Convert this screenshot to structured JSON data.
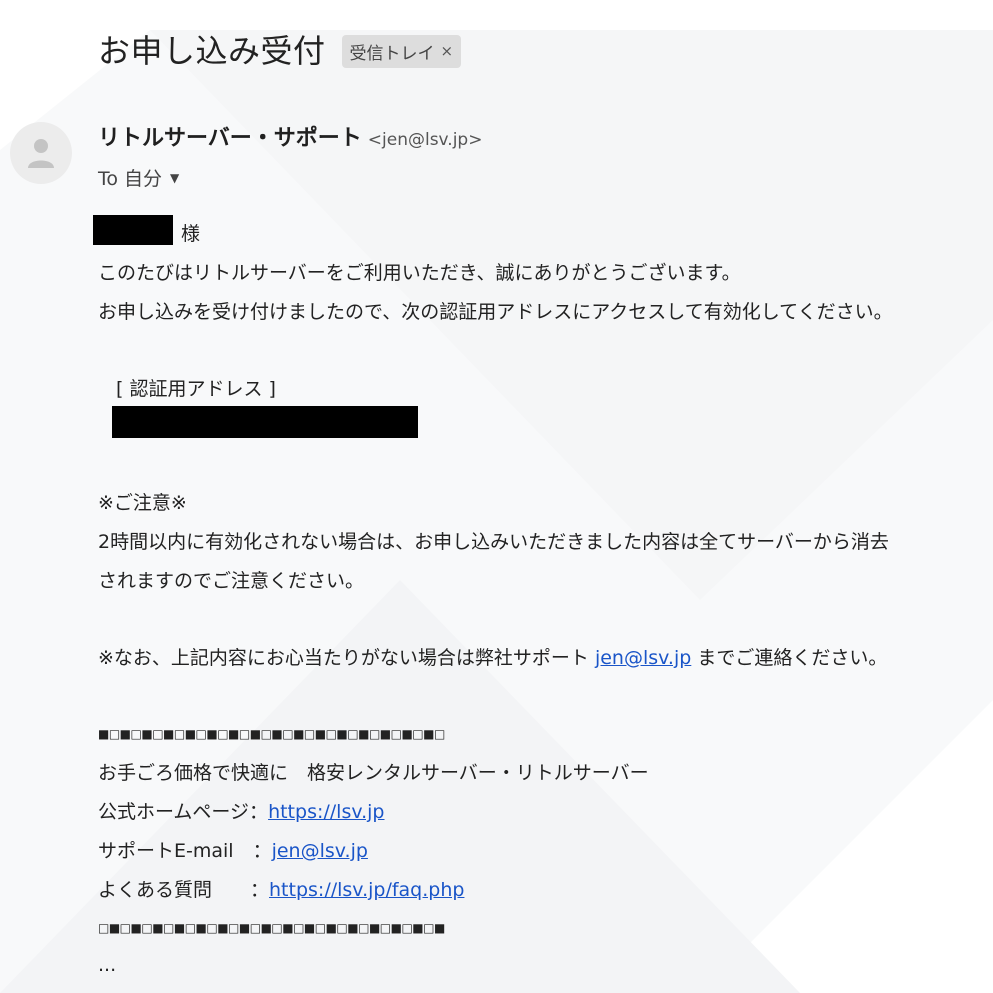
{
  "email": {
    "subject": "お申し込み受付",
    "label": {
      "text": "受信トレイ",
      "close": "×"
    },
    "sender": {
      "name": "リトルサーバー・サポート",
      "email": "<jen@lsv.jp>"
    },
    "recipient": "To 自分",
    "body": {
      "salutation_suffix": "様",
      "line_thanks": "このたびはリトルサーバーをご利用いただき、誠にありがとうございます。",
      "line_activate": "お申し込みを受け付けましたので、次の認証用アドレスにアクセスして有効化してください。",
      "auth_heading": "[ 認証用アドレス ]",
      "notice_heading": "※ご注意※",
      "notice_line1": "2時間以内に有効化されない場合は、お申し込みいただきました内容は全てサーバーから消去",
      "notice_line2": "されますのでご注意ください。",
      "contact_prefix": "※なお、上記内容にお心当たりがない場合は弊社サポート ",
      "contact_link": "jen@lsv.jp",
      "contact_suffix": " までご連絡ください。",
      "separator_top": "■□■□■□■□■□■□■□■□■□■□■□■□■□■□■□■□",
      "tagline": "お手ごろ価格で快適に　格安レンタルサーバー・リトルサーバー",
      "homepage_label": "公式ホームページ：",
      "homepage_link": "https://lsv.jp",
      "support_label": "サポートE-mail　：",
      "support_link": "jen@lsv.jp",
      "faq_label": "よくある質問　　：",
      "faq_link": "https://lsv.jp/faq.php",
      "separator_bottom": "□■□■□■□■□■□■□■□■□■□■□■□■□■□■□■□■",
      "ellipsis": "..."
    }
  },
  "colors": {
    "link": "#1a55c8",
    "chip_bg": "#dddddd",
    "redaction": "#000000"
  },
  "icons": {
    "avatar": "person-icon",
    "recipient_dropdown": "caret-down-icon"
  }
}
